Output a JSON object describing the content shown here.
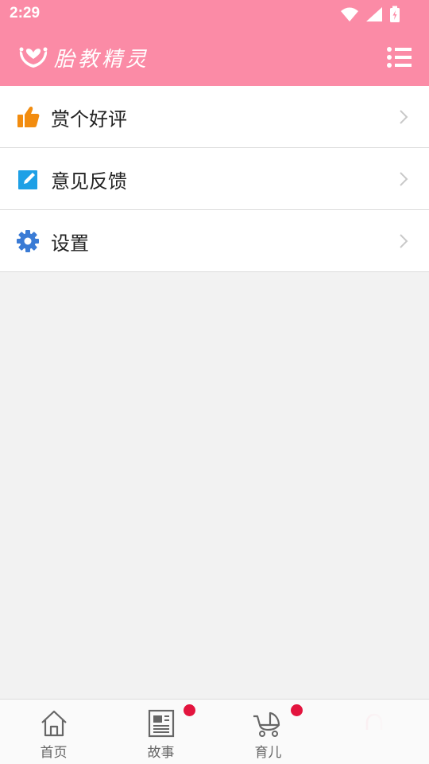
{
  "status_bar": {
    "time": "2:29"
  },
  "app_bar": {
    "title": "胎教精灵"
  },
  "menu": [
    {
      "label": "赏个好评",
      "icon": "thumbs-up-icon"
    },
    {
      "label": "意见反馈",
      "icon": "edit-icon"
    },
    {
      "label": "设置",
      "icon": "gear-icon"
    }
  ],
  "tabs": [
    {
      "label": "首页",
      "icon": "home-icon",
      "badge": false
    },
    {
      "label": "故事",
      "icon": "newspaper-icon",
      "badge": true
    },
    {
      "label": "育儿",
      "icon": "stroller-icon",
      "badge": true
    },
    {
      "label": "",
      "icon": "headphones-icon",
      "badge": false,
      "selected": true
    }
  ],
  "colors": {
    "primary": "#fb8ba6",
    "badge": "#e3143e",
    "thumbs": "#f28c0f",
    "edit": "#1ea0e6",
    "gear": "#3a7bd5"
  }
}
